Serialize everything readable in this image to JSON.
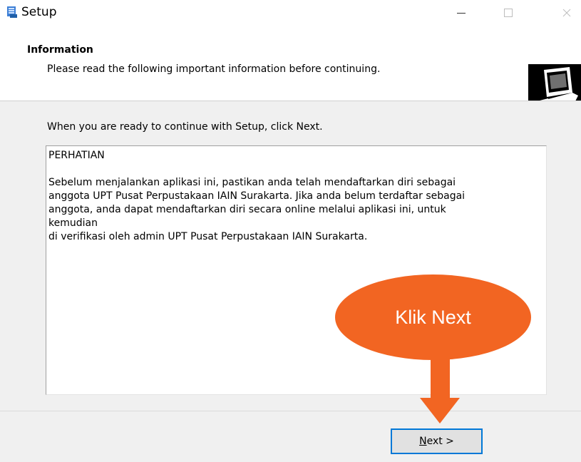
{
  "window": {
    "title": "Setup",
    "icon": "setup-icon",
    "controls": [
      "minimize-icon",
      "maximize-icon",
      "close-icon"
    ]
  },
  "header": {
    "title": "Information",
    "subtitle": "Please read the following important information before continuing.",
    "logo": "computer-setup-icon"
  },
  "main": {
    "prompt": "When you are ready to continue with Setup, click Next.",
    "info_lines": [
      "PERHATIAN",
      "",
      "Sebelum menjalankan aplikasi ini, pastikan anda telah mendaftarkan diri sebagai",
      "anggota UPT Pusat Perpustakaan IAIN Surakarta. Jika anda belum terdaftar sebagai",
      "anggota, anda dapat mendaftarkan diri secara online melalui aplikasi ini, untuk",
      "kemudian",
      "di verifikasi oleh admin UPT Pusat Perpustakaan IAIN Surakarta."
    ]
  },
  "buttons": {
    "next_label": "Next >"
  },
  "annotation": {
    "callout_text": "Klik Next",
    "color": "#f26522"
  },
  "colors": {
    "accent": "#0078d7",
    "dialog_bg": "#f0f0f0"
  }
}
